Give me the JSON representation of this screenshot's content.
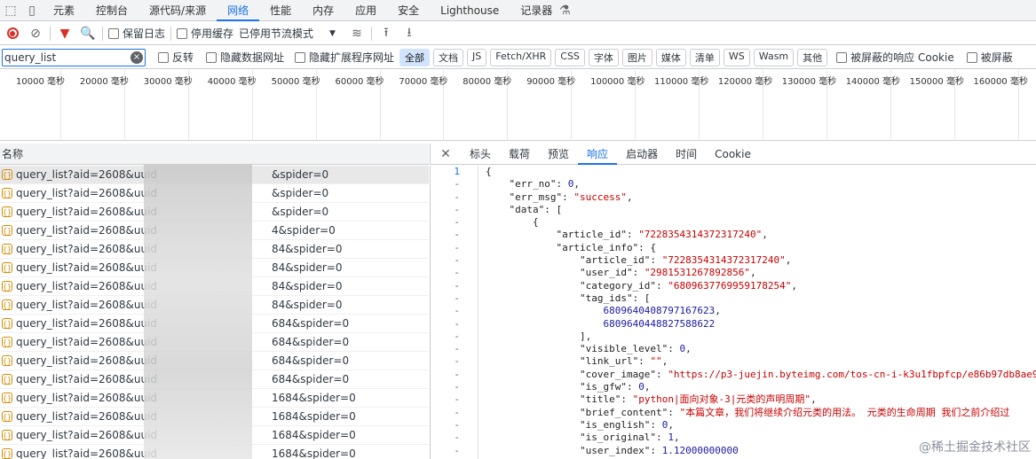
{
  "tabs": [
    "元素",
    "控制台",
    "源代码/来源",
    "网络",
    "性能",
    "内存",
    "应用",
    "安全",
    "Lighthouse",
    "记录器"
  ],
  "active_tab": "网络",
  "toolbar": {
    "preserve_log": "保留日志",
    "disable_cache": "停用缓存",
    "throttle": "已停用节流模式"
  },
  "filter": {
    "value": "query_list",
    "invert": "反转",
    "hide_data_urls": "隐藏数据网址",
    "hide_ext_urls": "隐藏扩展程序网址",
    "types": [
      "全部",
      "文档",
      "JS",
      "Fetch/XHR",
      "CSS",
      "字体",
      "图片",
      "媒体",
      "清单",
      "WS",
      "Wasm",
      "其他"
    ],
    "blocked_cookies": "被屏蔽的响应 Cookie",
    "blocked_requests": "被屏蔽"
  },
  "timeline": [
    "10000 毫秒",
    "20000 毫秒",
    "30000 毫秒",
    "40000 毫秒",
    "50000 毫秒",
    "60000 毫秒",
    "70000 毫秒",
    "80000 毫秒",
    "90000 毫秒",
    "100000 毫秒",
    "110000 毫秒",
    "120000 毫秒",
    "130000 毫秒",
    "140000 毫秒",
    "150000 毫秒",
    "160000 毫秒"
  ],
  "list": {
    "header": "名称",
    "rows": [
      {
        "left": "query_list?aid=2608&uuid=",
        "right": "&spider=0"
      },
      {
        "left": "query_list?aid=2608&uuid=",
        "right": "&spider=0"
      },
      {
        "left": "query_list?aid=2608&uuid=",
        "right": "&spider=0"
      },
      {
        "left": "query_list?aid=2608&uuid=",
        "right": "4&spider=0"
      },
      {
        "left": "query_list?aid=2608&uuid=",
        "right": "84&spider=0"
      },
      {
        "left": "query_list?aid=2608&uuid=",
        "right": "84&spider=0"
      },
      {
        "left": "query_list?aid=2608&uuid=",
        "right": "84&spider=0"
      },
      {
        "left": "query_list?aid=2608&uuid=",
        "right": "84&spider=0"
      },
      {
        "left": "query_list?aid=2608&uuid=",
        "right": "684&spider=0"
      },
      {
        "left": "query_list?aid=2608&uuid=",
        "right": "684&spider=0"
      },
      {
        "left": "query_list?aid=2608&uuid=",
        "right": "684&spider=0"
      },
      {
        "left": "query_list?aid=2608&uuid=",
        "right": "684&spider=0"
      },
      {
        "left": "query_list?aid=2608&uuid=",
        "right": "1684&spider=0"
      },
      {
        "left": "query_list?aid=2608&uuid=",
        "right": "1684&spider=0"
      },
      {
        "left": "query_list?aid=2608&uuid=",
        "right": "1684&spider=0"
      },
      {
        "left": "query_list?aid=2608&uuid=",
        "right": "1684&spider=0"
      }
    ]
  },
  "detail_tabs": [
    "标头",
    "载荷",
    "预览",
    "响应",
    "启动器",
    "时间",
    "Cookie"
  ],
  "active_detail": "响应",
  "code": {
    "gutter": [
      "1",
      "-",
      "-",
      "-",
      "-",
      "-",
      "-",
      "-",
      "-",
      "-",
      "-",
      "-",
      "-",
      "-",
      "-",
      "-",
      "-",
      "-",
      "-",
      "-",
      "-",
      "-",
      "-"
    ],
    "lines": [
      "{",
      "    \"err_no\": 0,",
      "    \"err_msg\": \"success\",",
      "    \"data\": [",
      "        {",
      "            \"article_id\": \"7228354314372317240\",",
      "            \"article_info\": {",
      "                \"article_id\": \"7228354314372317240\",",
      "                \"user_id\": \"2981531267892856\",",
      "                \"category_id\": \"6809637769959178254\",",
      "                \"tag_ids\": [",
      "                    6809640408797167623,",
      "                    6809640448827588622",
      "                ],",
      "                \"visible_level\": 0,",
      "                \"link_url\": \"\",",
      "                \"cover_image\": \"https://p3-juejin.byteimg.com/tos-cn-i-k3u1fbpfcp/e86b97db8ae9",
      "                \"is_gfw\": 0,",
      "                \"title\": \"python|面向对象-3|元类的声明周期\",",
      "                \"brief_content\": \"本篇文章，我们将继续介绍元类的用法。 元类的生命周期 我们之前介绍过",
      "                \"is_english\": 0,",
      "                \"is_original\": 1,",
      "                \"user_index\": 1.12000000000"
    ]
  },
  "watermark": "@稀土掘金技术社区"
}
